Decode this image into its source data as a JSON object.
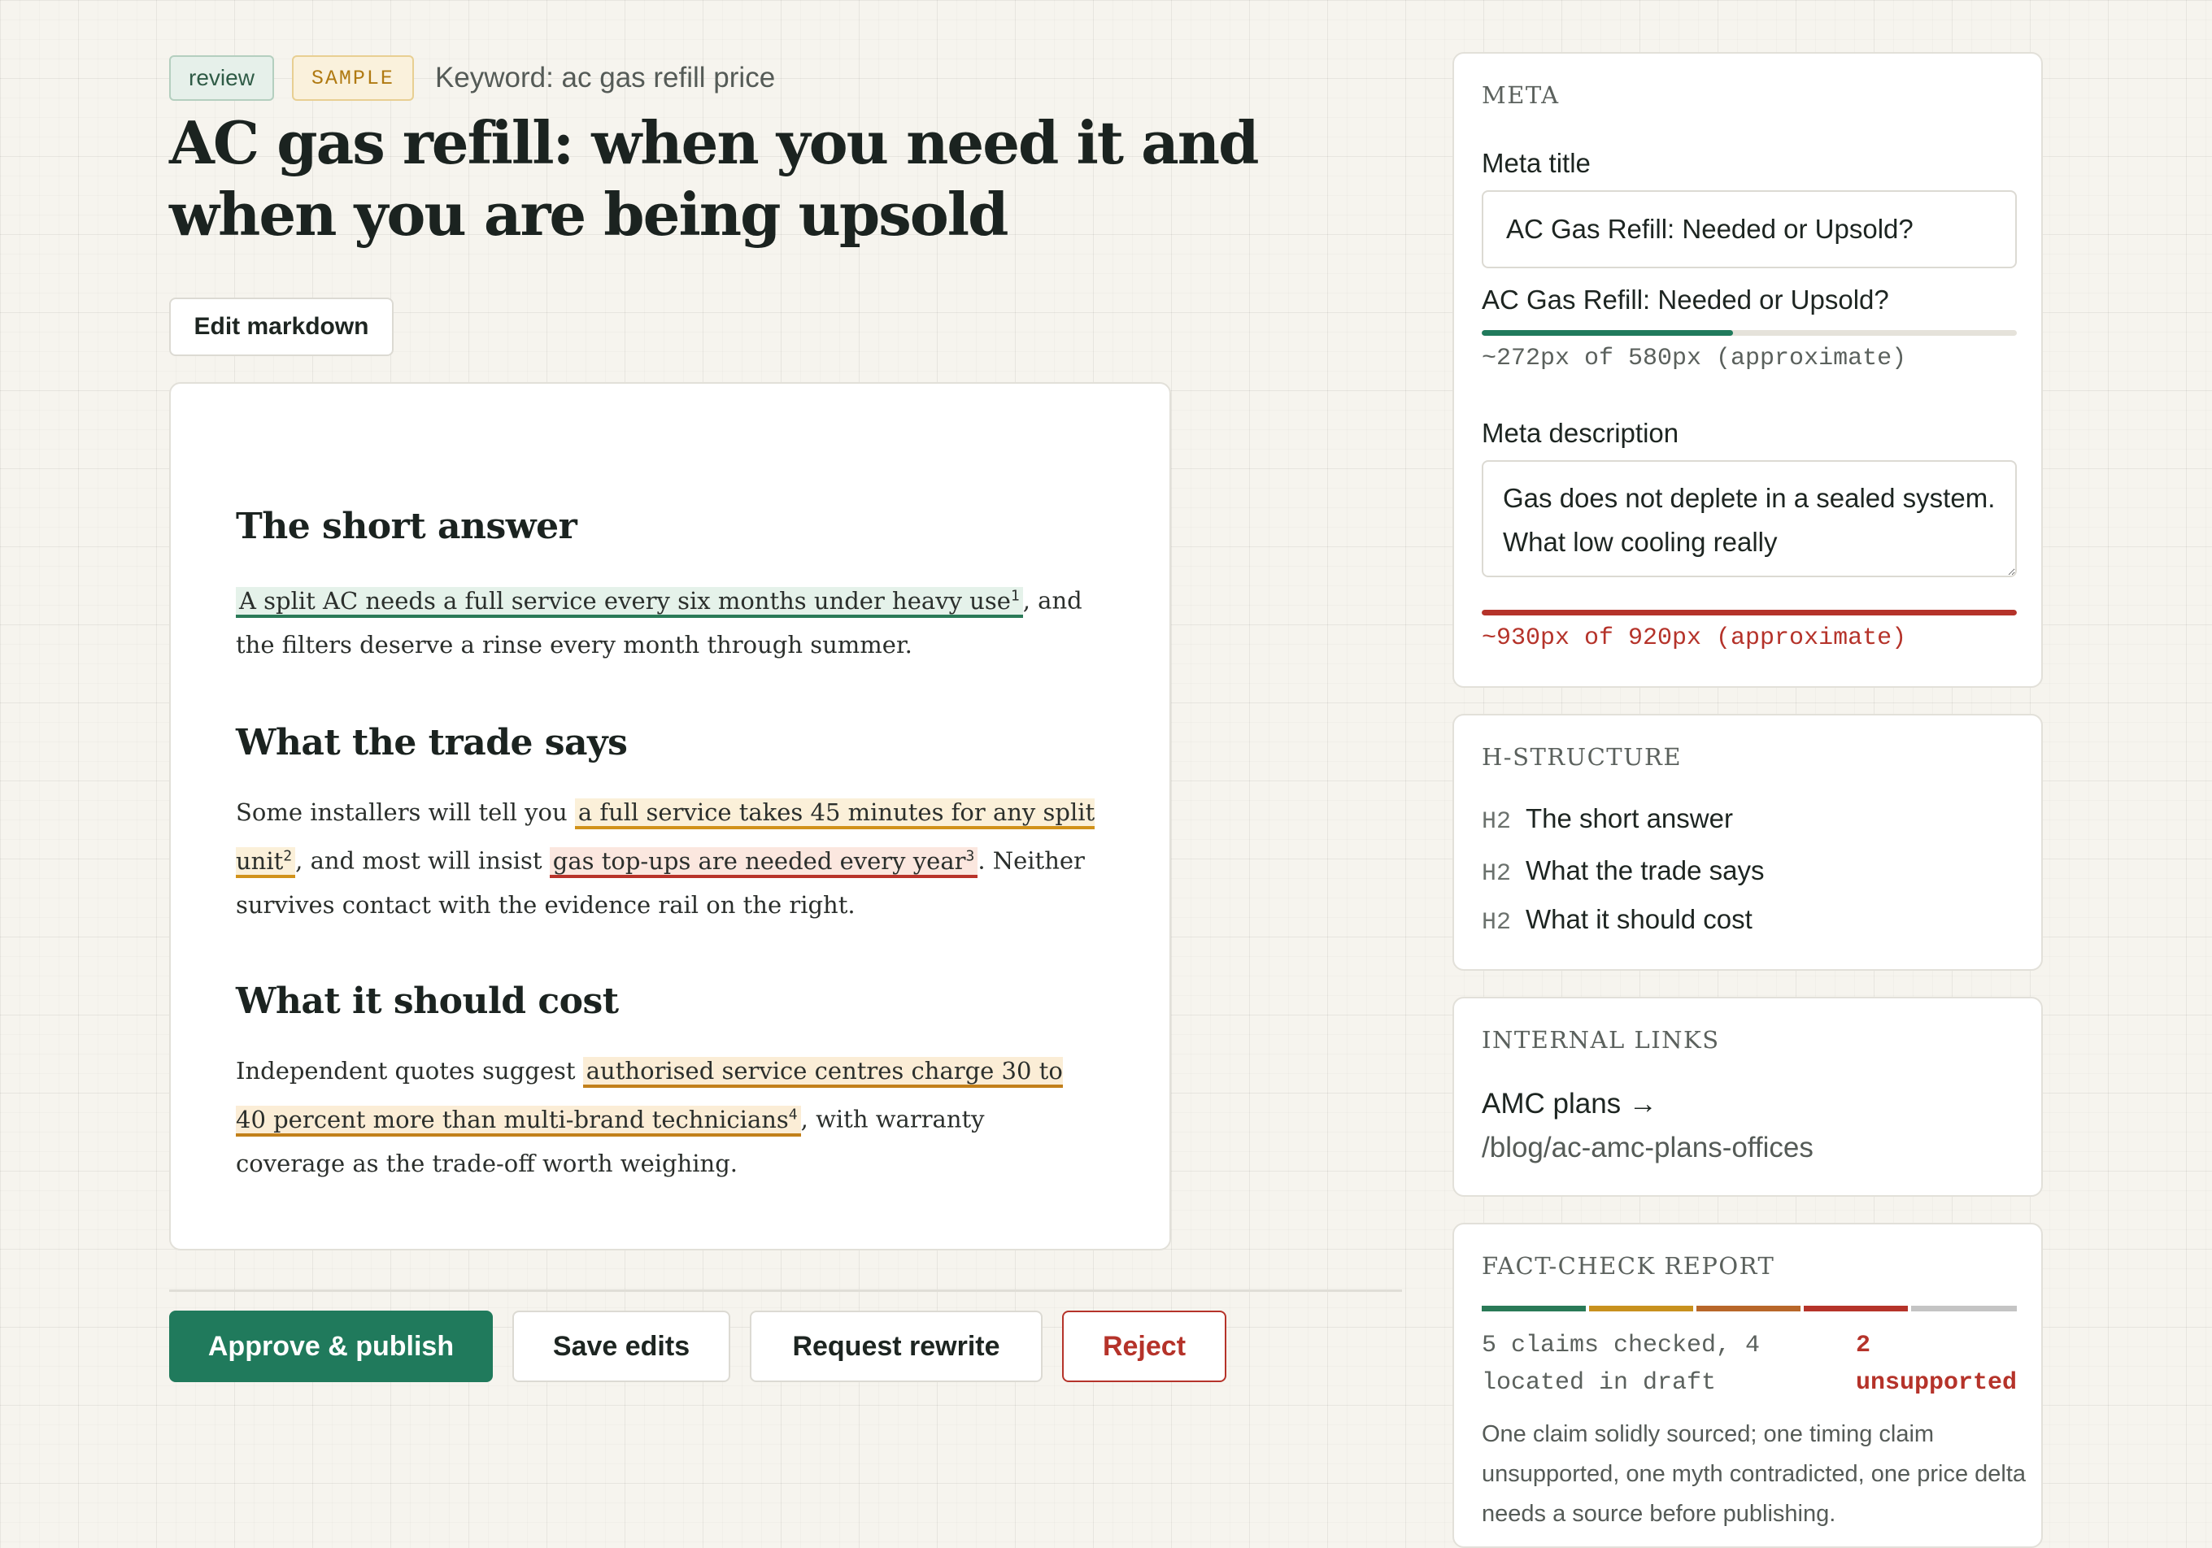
{
  "header": {
    "status_badge": "review",
    "sample_badge": "SAMPLE",
    "keyword": "Keyword: ac gas refill price",
    "title": "AC gas refill: when you need it and when you are being upsold",
    "edit_label": "Edit markdown"
  },
  "article": {
    "sections": [
      {
        "heading": "The short answer",
        "before": "",
        "claim": "A split AC needs a full service every six months under heavy use",
        "claim_ref": "1",
        "mid": ", and the filters deserve a rinse every month through summer.",
        "claim2": "",
        "claim2_ref": "",
        "after": ""
      },
      {
        "heading": "What the trade says",
        "before": "Some installers will tell you ",
        "claim": "a full service takes 45 minutes for any split unit",
        "claim_ref": "2",
        "mid": ", and most will insist ",
        "claim2": "gas top-ups are needed every year",
        "claim2_ref": "3",
        "after": ". Neither survives contact with the evidence rail on the right."
      },
      {
        "heading": "What it should cost",
        "before": "Independent quotes suggest ",
        "claim": "authorised service centres charge 30 to 40 percent more than multi-brand technicians",
        "claim_ref": "4",
        "mid": ", with warranty coverage as the trade-off worth weighing.",
        "claim2": "",
        "claim2_ref": "",
        "after": ""
      }
    ]
  },
  "actions": {
    "approve": "Approve & publish",
    "save": "Save edits",
    "rewrite": "Request rewrite",
    "reject": "Reject"
  },
  "meta": {
    "section_title": "META",
    "meta_title_label": "Meta title",
    "meta_title_value": "AC Gas Refill: Needed or Upsold?",
    "meta_title_preview": "AC Gas Refill: Needed or Upsold?",
    "title_measure": "~272px of 580px (approximate)",
    "title_fill": 0.469,
    "meta_desc_label": "Meta description",
    "meta_desc_value": "Gas does not deplete in a sealed system. What low cooling really",
    "desc_measure": "~930px of 920px (approximate)",
    "desc_fill": 1.0
  },
  "h_structure": {
    "section_title": "H-STRUCTURE",
    "items": [
      {
        "tag": "H2",
        "text": "The short answer"
      },
      {
        "tag": "H2",
        "text": "What the trade says"
      },
      {
        "tag": "H2",
        "text": "What it should cost"
      }
    ]
  },
  "internal_links": {
    "section_title": "INTERNAL LINKS",
    "link_text": "AMC plans →",
    "link_path": "/blog/ac-amc-plans-offices"
  },
  "fact_check": {
    "section_title": "FACT-CHECK REPORT",
    "summary": "5 claims checked, 4 located in draft",
    "unsupported": "2 unsupported",
    "note": "One claim solidly sourced; one timing claim unsupported, one myth contradicted, one price delta needs a source before publishing."
  },
  "colors": {
    "accent": "#207a5c",
    "warning": "#d1921a",
    "danger": "#b5332a",
    "background": "#f6f4ee",
    "segments": [
      "#2a7a57",
      "#c8911e",
      "#b8672a",
      "#b5332a",
      "#c4c4c4"
    ]
  }
}
